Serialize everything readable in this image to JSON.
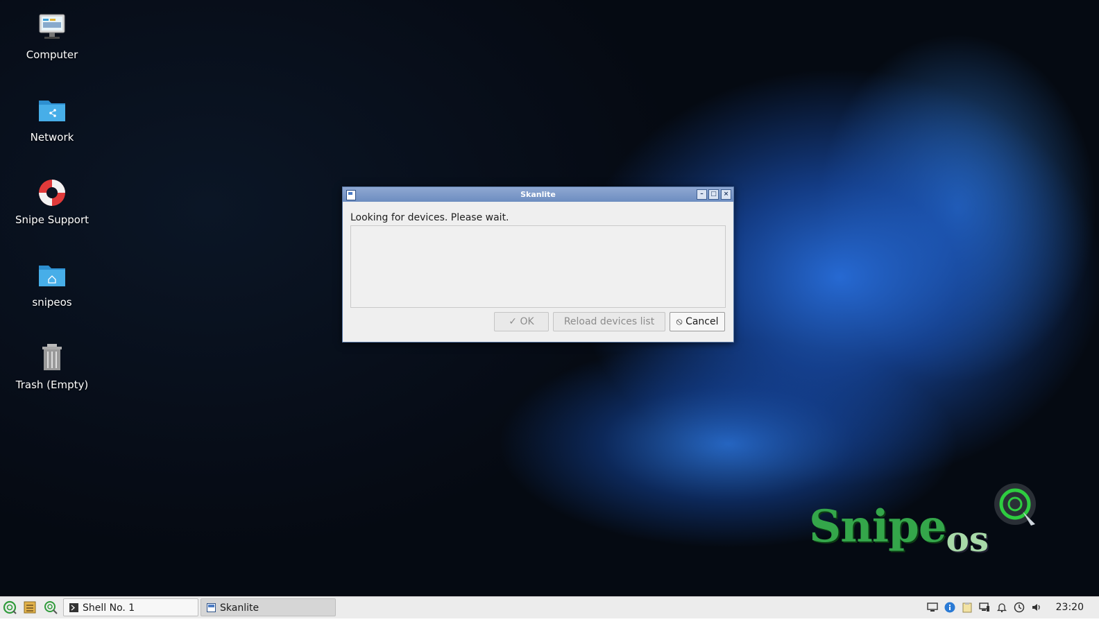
{
  "desktop": {
    "icons": [
      {
        "label": "Computer"
      },
      {
        "label": "Network"
      },
      {
        "label": "Snipe Support"
      },
      {
        "label": "snipeos"
      },
      {
        "label": "Trash (Empty)"
      }
    ],
    "wallpaper_brand": {
      "text_main": "Snipe",
      "text_sub": "os"
    }
  },
  "dialog": {
    "title": "Skanlite",
    "message": "Looking for devices. Please wait.",
    "buttons": {
      "ok": {
        "label": "OK",
        "enabled": false
      },
      "reload": {
        "label": "Reload devices list",
        "enabled": false
      },
      "cancel": {
        "label": "Cancel",
        "enabled": true
      }
    },
    "titlebar_controls": [
      "minimize-icon",
      "maximize-icon",
      "close-icon"
    ]
  },
  "taskbar": {
    "launchers": [
      "snipe-menu-icon",
      "file-manager-icon",
      "search-icon"
    ],
    "tasks": [
      {
        "label": "Shell No. 1",
        "icon": "terminal-icon",
        "active": false
      },
      {
        "label": "Skanlite",
        "icon": "skanlite-icon",
        "active": true
      }
    ],
    "tray_icons": [
      "display-icon",
      "info-icon",
      "clipboard-icon",
      "network-icon",
      "notification-bell-icon",
      "update-icon",
      "volume-icon"
    ],
    "clock": "23:20"
  },
  "colors": {
    "taskbar_bg": "#ececec",
    "titlebar": "#7a97c9",
    "brand_green": "#34a64a"
  }
}
